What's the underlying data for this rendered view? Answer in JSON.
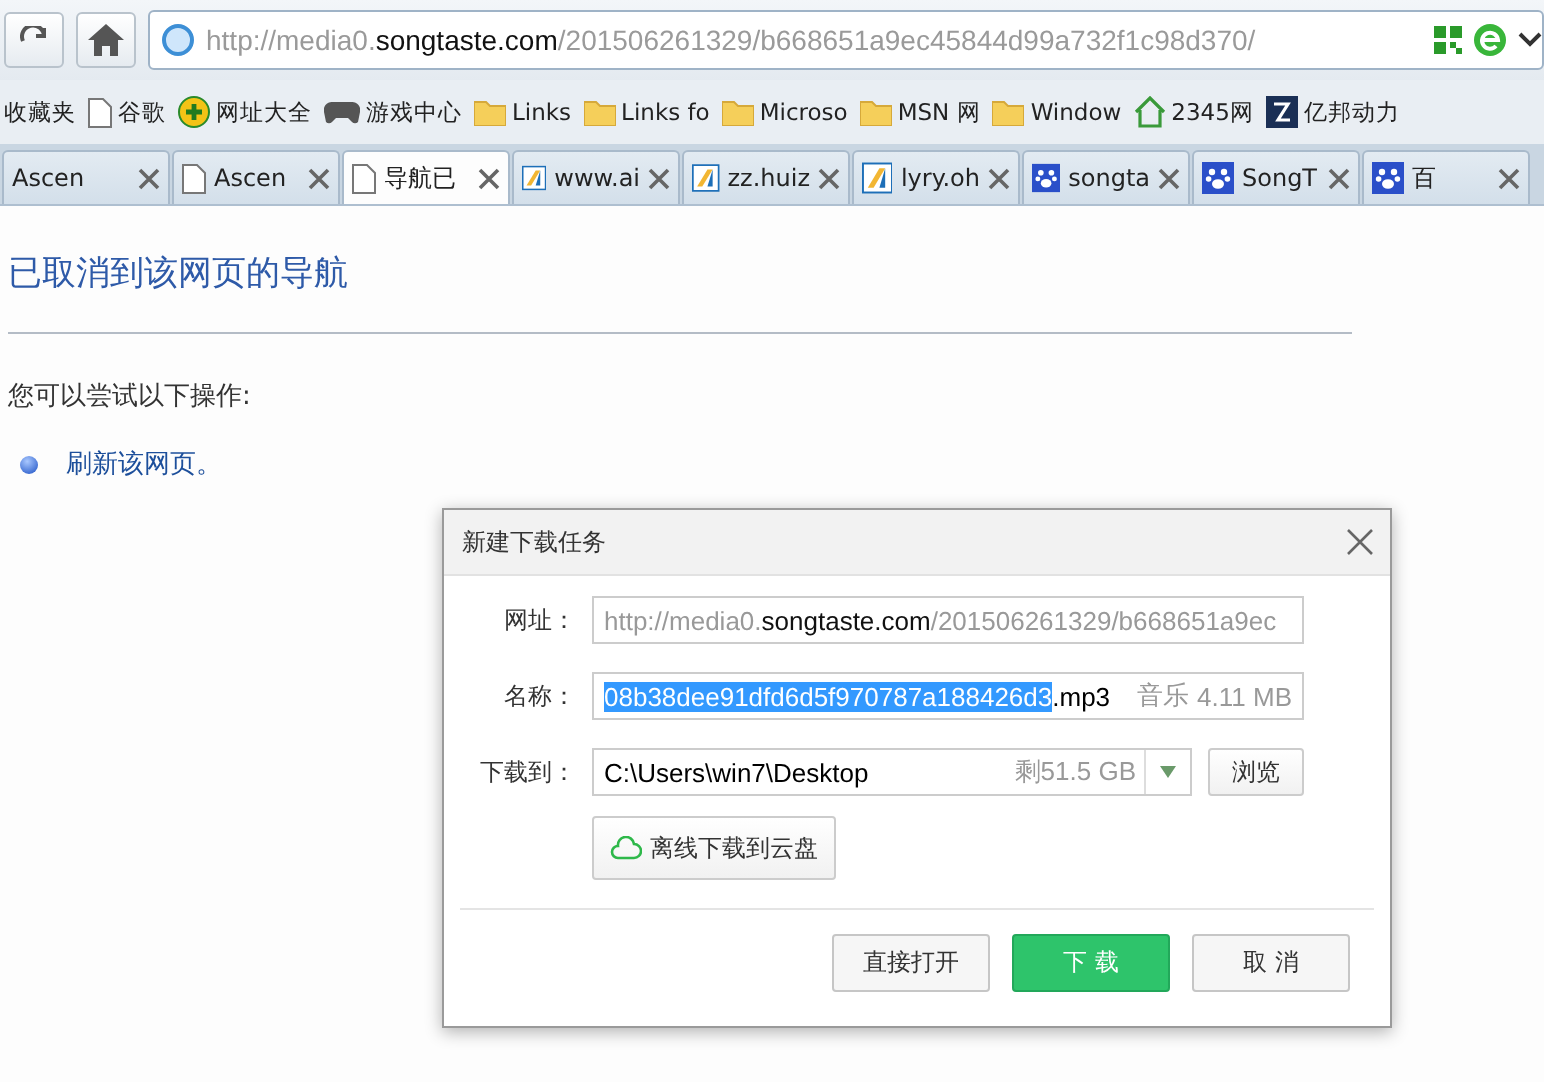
{
  "toolbar": {
    "url_scheme": "http://media0.",
    "url_host": "songtaste.com",
    "url_path": "/201506261329/b668651a9ec45844d99a732f1c98d370/"
  },
  "bookmarks": [
    {
      "label": "收藏夹",
      "kind": "none"
    },
    {
      "label": "谷歌",
      "kind": "page"
    },
    {
      "label": "网址大全",
      "kind": "site"
    },
    {
      "label": "游戏中心",
      "kind": "game"
    },
    {
      "label": "Links",
      "kind": "folder"
    },
    {
      "label": "Links fo",
      "kind": "folder"
    },
    {
      "label": "Microso",
      "kind": "folder"
    },
    {
      "label": "MSN 网",
      "kind": "folder"
    },
    {
      "label": "Window",
      "kind": "folder"
    },
    {
      "label": "2345网",
      "kind": "house"
    },
    {
      "label": "亿邦动力",
      "kind": "yi"
    }
  ],
  "tabs": [
    {
      "label": "Ascen",
      "kind": "none",
      "selected": false
    },
    {
      "label": "Ascen",
      "kind": "page",
      "selected": false
    },
    {
      "label": "导航已",
      "kind": "page",
      "selected": true
    },
    {
      "label": "www.ai",
      "kind": "site",
      "selected": false
    },
    {
      "label": "zz.huiz",
      "kind": "site",
      "selected": false
    },
    {
      "label": "lyry.oh",
      "kind": "site",
      "selected": false
    },
    {
      "label": "songta",
      "kind": "paw",
      "selected": false
    },
    {
      "label": "SongT",
      "kind": "paw",
      "selected": false
    },
    {
      "label": "百",
      "kind": "paw",
      "selected": false
    }
  ],
  "page": {
    "title": "已取消到该网页的导航",
    "hint": "您可以尝试以下操作:",
    "actions": [
      "刷新该网页。"
    ]
  },
  "dialog": {
    "title": "新建下载任务",
    "url_label": "网址：",
    "url_scheme": "http://media0.",
    "url_host": "songtaste.com",
    "url_path": "/201506261329/b668651a9ec",
    "name_label": "名称：",
    "name_selected": "08b38dee91dfd6d5f970787a188426d3",
    "name_ext": ".mp3",
    "file_type": "音乐",
    "file_size": "4.11 MB",
    "dest_label": "下载到：",
    "dest_path": "C:\\Users\\win7\\Desktop",
    "free_space": "剩51.5 GB",
    "browse": "浏览",
    "cloud": "离线下载到云盘",
    "open": "直接打开",
    "download": "下 载",
    "cancel": "取 消"
  }
}
